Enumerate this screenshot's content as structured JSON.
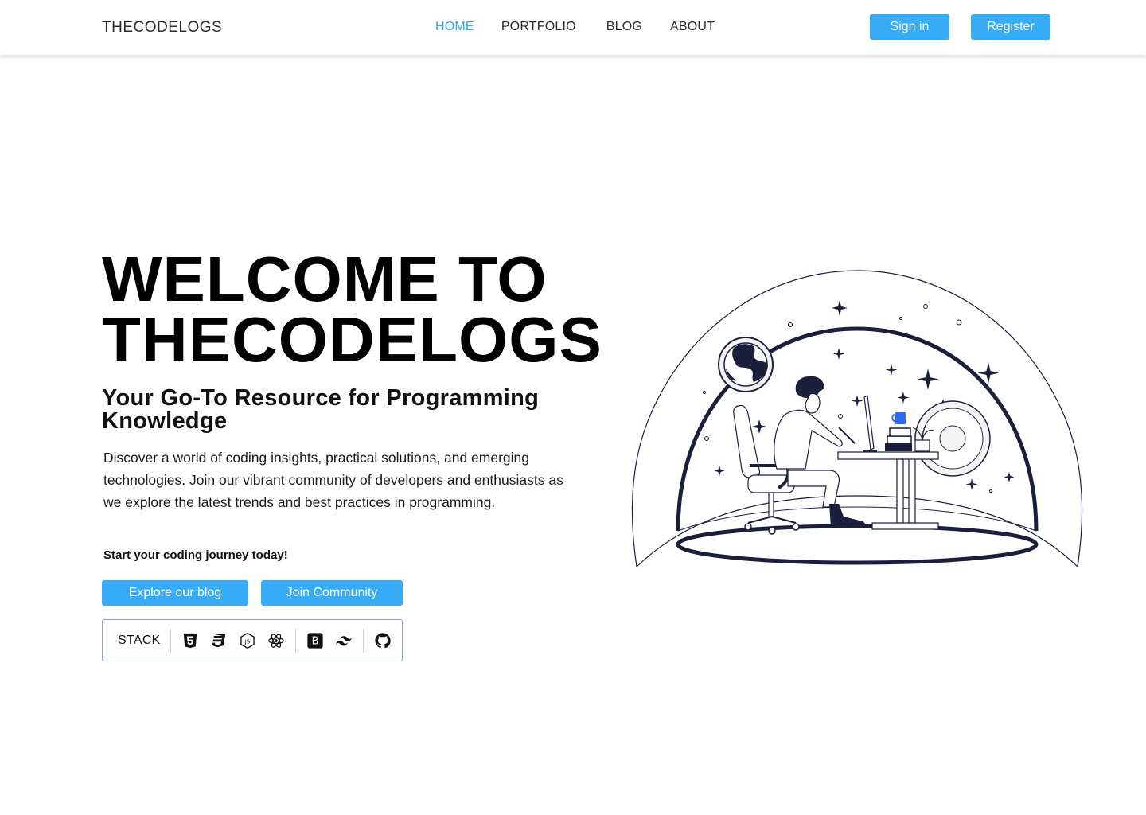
{
  "brand": {
    "name": "THECODELOGS"
  },
  "nav": {
    "links": [
      {
        "label": "HOME",
        "active": true
      },
      {
        "label": "PORTFOLIO",
        "active": false
      },
      {
        "label": "BLOG",
        "active": false
      },
      {
        "label": "ABOUT",
        "active": false
      }
    ],
    "sign_in_label": "Sign in",
    "register_label": "Register"
  },
  "hero": {
    "title_line1": "WELCOME TO",
    "title_line2": "THECODELOGS",
    "subtitle": "Your Go-To Resource for Programming Knowledge",
    "description": "Discover a world of coding insights, practical solutions, and emerging technologies. Join our vibrant community of developers and enthusiasts as we explore the latest trends and best practices in programming.",
    "cta_text": "Start your coding journey today!",
    "explore_button": "Explore our blog",
    "community_button": "Join Community"
  },
  "stack": {
    "label": "STACK",
    "badge_letter": "B",
    "icons": [
      "html5-icon",
      "css3-icon",
      "nodejs-icon",
      "react-icon",
      "bootstrap-icon",
      "tailwind-icon",
      "github-icon"
    ]
  },
  "colors": {
    "accent": "#36acf6",
    "active_link": "#2ea8f0",
    "illustration_navy": "#1b1f3b",
    "mug_blue": "#2f6bf0"
  }
}
